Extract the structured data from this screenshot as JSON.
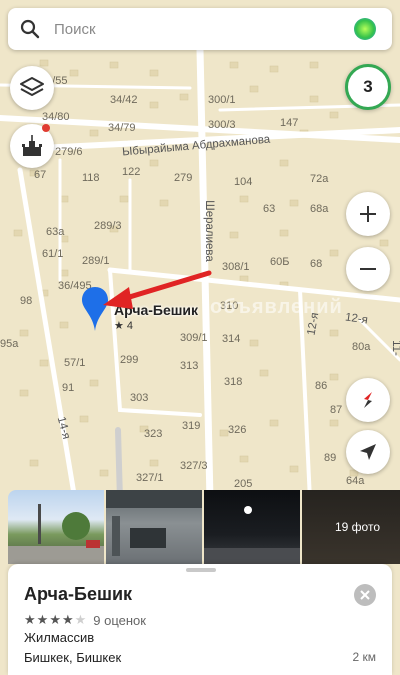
{
  "search": {
    "placeholder": "Поиск"
  },
  "traffic": {
    "level": "3",
    "color": "#34a853"
  },
  "map": {
    "streets": [
      "Ыбырайыма Абдрахманова",
      "Шералиева",
      "12-я",
      "12-я",
      "14-я",
      "11-"
    ],
    "house_numbers": [
      "34/55",
      "34/42",
      "300/1",
      "34/80",
      "34/79",
      "300/3",
      "147",
      "279/6",
      "122",
      "279",
      "67",
      "118",
      "104",
      "72а",
      "63",
      "289/3",
      "68а",
      "63а",
      "61/1",
      "289/1",
      "308/1",
      "60Б",
      "68",
      "36/495",
      "310",
      "98",
      "95а",
      "314",
      "80а",
      "57/1",
      "299",
      "309/1",
      "313",
      "318",
      "86",
      "91",
      "303",
      "323",
      "319",
      "326",
      "327/3",
      "327/1",
      "87",
      "89",
      "64а",
      "205"
    ],
    "watermark": "объявлений"
  },
  "poi": {
    "name": "Арча-Бешик",
    "rating": "★ 4",
    "pin_color": "#1e6fe8"
  },
  "annotation": {
    "arrow_color": "#e02424"
  },
  "photos": {
    "count_label": "19 фото"
  },
  "card": {
    "title": "Арча-Бешик",
    "stars": 4,
    "reviews": "9 оценок",
    "category": "Жилмассив",
    "address": "Бишкек, Бишкек",
    "distance": "2 км"
  },
  "icons": [
    "search-icon",
    "alice-assistant-icon",
    "layers-icon",
    "landmark-icon",
    "zoom-in-icon",
    "zoom-out-icon",
    "compass-icon",
    "my-location-icon",
    "close-icon"
  ]
}
